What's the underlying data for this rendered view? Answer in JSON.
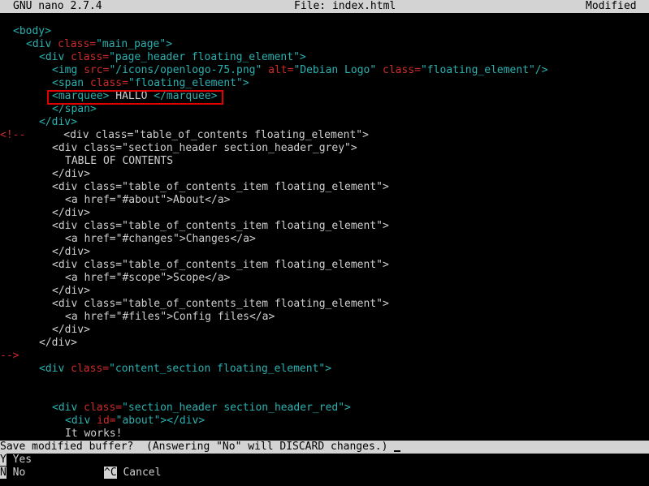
{
  "titlebar": {
    "app": "GNU nano 2.7.4",
    "file": "File: index.html",
    "status": "Modified"
  },
  "code": [
    {
      "indent": 2,
      "segs": [
        [
          "tag",
          "<body>"
        ]
      ]
    },
    {
      "indent": 4,
      "segs": [
        [
          "tag",
          "<div "
        ],
        [
          "attr",
          "class="
        ],
        [
          "str",
          "\"main_page\""
        ],
        [
          "tag",
          ">"
        ]
      ]
    },
    {
      "indent": 6,
      "segs": [
        [
          "tag",
          "<div "
        ],
        [
          "attr",
          "class="
        ],
        [
          "str",
          "\"page_header floating_element\""
        ],
        [
          "tag",
          ">"
        ]
      ]
    },
    {
      "indent": 8,
      "segs": [
        [
          "tag",
          "<img "
        ],
        [
          "attr",
          "src="
        ],
        [
          "str",
          "\"/icons/openlogo-75.png\" "
        ],
        [
          "attr",
          "alt="
        ],
        [
          "str",
          "\"Debian Logo\" "
        ],
        [
          "attr",
          "class="
        ],
        [
          "str",
          "\"floating_element\""
        ],
        [
          "tag",
          "/>"
        ]
      ]
    },
    {
      "indent": 8,
      "segs": [
        [
          "tag",
          "<span "
        ],
        [
          "attr",
          "class="
        ],
        [
          "str",
          "\"floating_element\""
        ],
        [
          "tag",
          ">"
        ]
      ]
    },
    {
      "indent": 8,
      "segs": [
        [
          "tag",
          "<marquee>"
        ],
        [
          "txt",
          " HALLO "
        ],
        [
          "tag",
          "</marquee>"
        ]
      ]
    },
    {
      "indent": 8,
      "segs": [
        [
          "tag",
          "</span>"
        ]
      ]
    },
    {
      "indent": 6,
      "segs": [
        [
          "tag",
          "</div>"
        ]
      ]
    },
    {
      "indent": 0,
      "segs": [
        [
          "attr",
          "<!--"
        ],
        [
          "txt",
          "      "
        ],
        [
          "txt",
          "<div class=\"table_of_contents floating_element\">"
        ]
      ]
    },
    {
      "indent": 8,
      "segs": [
        [
          "txt",
          "<div class=\"section_header section_header_grey\">"
        ]
      ]
    },
    {
      "indent": 10,
      "segs": [
        [
          "txt",
          "TABLE OF CONTENTS"
        ]
      ]
    },
    {
      "indent": 8,
      "segs": [
        [
          "txt",
          "</div>"
        ]
      ]
    },
    {
      "indent": 8,
      "segs": [
        [
          "txt",
          "<div class=\"table_of_contents_item floating_element\">"
        ]
      ]
    },
    {
      "indent": 10,
      "segs": [
        [
          "txt",
          "<a href=\"#about\">About</a>"
        ]
      ]
    },
    {
      "indent": 8,
      "segs": [
        [
          "txt",
          "</div>"
        ]
      ]
    },
    {
      "indent": 8,
      "segs": [
        [
          "txt",
          "<div class=\"table_of_contents_item floating_element\">"
        ]
      ]
    },
    {
      "indent": 10,
      "segs": [
        [
          "txt",
          "<a href=\"#changes\">Changes</a>"
        ]
      ]
    },
    {
      "indent": 8,
      "segs": [
        [
          "txt",
          "</div>"
        ]
      ]
    },
    {
      "indent": 8,
      "segs": [
        [
          "txt",
          "<div class=\"table_of_contents_item floating_element\">"
        ]
      ]
    },
    {
      "indent": 10,
      "segs": [
        [
          "txt",
          "<a href=\"#scope\">Scope</a>"
        ]
      ]
    },
    {
      "indent": 8,
      "segs": [
        [
          "txt",
          "</div>"
        ]
      ]
    },
    {
      "indent": 8,
      "segs": [
        [
          "txt",
          "<div class=\"table_of_contents_item floating_element\">"
        ]
      ]
    },
    {
      "indent": 10,
      "segs": [
        [
          "txt",
          "<a href=\"#files\">Config files</a>"
        ]
      ]
    },
    {
      "indent": 8,
      "segs": [
        [
          "txt",
          "</div>"
        ]
      ]
    },
    {
      "indent": 6,
      "segs": [
        [
          "txt",
          "</div>"
        ]
      ]
    },
    {
      "indent": 0,
      "segs": [
        [
          "attr",
          "-->"
        ]
      ]
    },
    {
      "indent": 6,
      "segs": [
        [
          "tag",
          "<div "
        ],
        [
          "attr",
          "class="
        ],
        [
          "str",
          "\"content_section floating_element\""
        ],
        [
          "tag",
          ">"
        ]
      ]
    },
    {
      "indent": 0,
      "segs": []
    },
    {
      "indent": 0,
      "segs": []
    },
    {
      "indent": 8,
      "segs": [
        [
          "tag",
          "<div "
        ],
        [
          "attr",
          "class="
        ],
        [
          "str",
          "\"section_header section_header_red\""
        ],
        [
          "tag",
          ">"
        ]
      ]
    },
    {
      "indent": 10,
      "segs": [
        [
          "tag",
          "<div "
        ],
        [
          "attr",
          "id="
        ],
        [
          "str",
          "\"about\""
        ],
        [
          "tag",
          "></div>"
        ]
      ]
    },
    {
      "indent": 10,
      "segs": [
        [
          "txt",
          "It works!"
        ]
      ]
    }
  ],
  "prompt": "Save modified buffer?  (Answering \"No\" will DISCARD changes.) ",
  "shortcuts": [
    {
      "key": "Y",
      "label": "Yes"
    },
    {
      "key": "N",
      "label": "No"
    },
    {
      "key": "^C",
      "label": "Cancel"
    }
  ]
}
